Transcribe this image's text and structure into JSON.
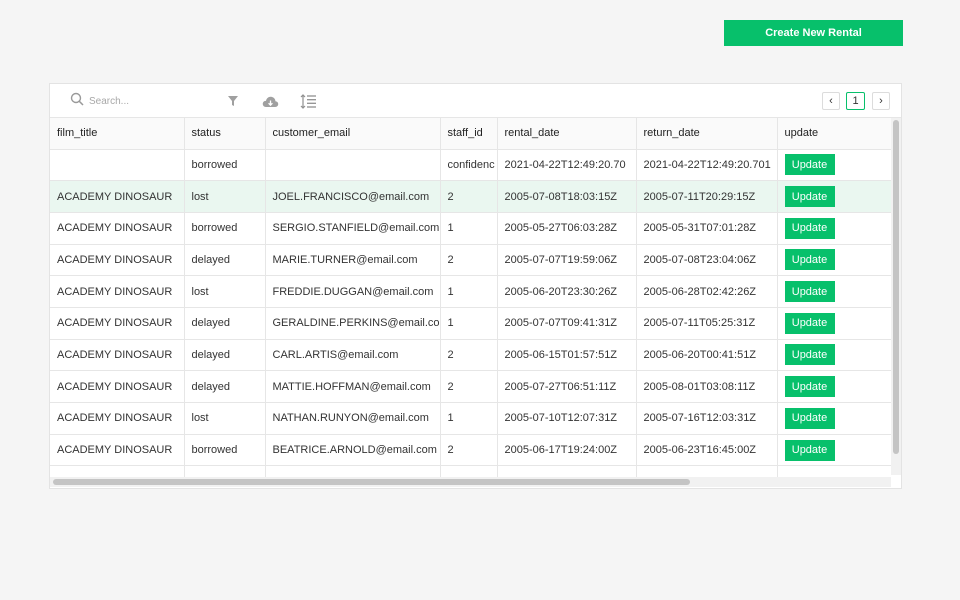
{
  "header": {
    "create_label": "Create New Rental"
  },
  "toolbar": {
    "search_placeholder": "Search...",
    "icons": [
      "search-icon",
      "filter-icon",
      "cloud-download-icon",
      "row-height-icon"
    ]
  },
  "pagination": {
    "prev": "‹",
    "current": "1",
    "next": "›"
  },
  "table": {
    "columns": [
      "film_title",
      "status",
      "customer_email",
      "staff_id",
      "rental_date",
      "return_date",
      "update"
    ],
    "update_label": "Update",
    "rows": [
      [
        "",
        "borrowed",
        "",
        "confidenc",
        "2021-04-22T12:49:20.70",
        "2021-04-22T12:49:20.701"
      ],
      [
        "ACADEMY DINOSAUR",
        "lost",
        "JOEL.FRANCISCO@email.com",
        "2",
        "2005-07-08T18:03:15Z",
        "2005-07-11T20:29:15Z"
      ],
      [
        "ACADEMY DINOSAUR",
        "borrowed",
        "SERGIO.STANFIELD@email.com",
        "1",
        "2005-05-27T06:03:28Z",
        "2005-05-31T07:01:28Z"
      ],
      [
        "ACADEMY DINOSAUR",
        "delayed",
        "MARIE.TURNER@email.com",
        "2",
        "2005-07-07T19:59:06Z",
        "2005-07-08T23:04:06Z"
      ],
      [
        "ACADEMY DINOSAUR",
        "lost",
        "FREDDIE.DUGGAN@email.com",
        "1",
        "2005-06-20T23:30:26Z",
        "2005-06-28T02:42:26Z"
      ],
      [
        "ACADEMY DINOSAUR",
        "delayed",
        "GERALDINE.PERKINS@email.com",
        "1",
        "2005-07-07T09:41:31Z",
        "2005-07-11T05:25:31Z"
      ],
      [
        "ACADEMY DINOSAUR",
        "delayed",
        "CARL.ARTIS@email.com",
        "2",
        "2005-06-15T01:57:51Z",
        "2005-06-20T00:41:51Z"
      ],
      [
        "ACADEMY DINOSAUR",
        "delayed",
        "MATTIE.HOFFMAN@email.com",
        "2",
        "2005-07-27T06:51:11Z",
        "2005-08-01T03:08:11Z"
      ],
      [
        "ACADEMY DINOSAUR",
        "lost",
        "NATHAN.RUNYON@email.com",
        "1",
        "2005-07-10T12:07:31Z",
        "2005-07-16T12:03:31Z"
      ],
      [
        "ACADEMY DINOSAUR",
        "borrowed",
        "BEATRICE.ARNOLD@email.com",
        "2",
        "2005-06-17T19:24:00Z",
        "2005-06-23T16:45:00Z"
      ],
      [
        "",
        "",
        "",
        "",
        "",
        ""
      ]
    ],
    "selected_row_index": 1
  },
  "colors": {
    "accent": "#07c06b",
    "selected_row": "#eaf7f0",
    "page_bg": "#f5f5f5"
  }
}
